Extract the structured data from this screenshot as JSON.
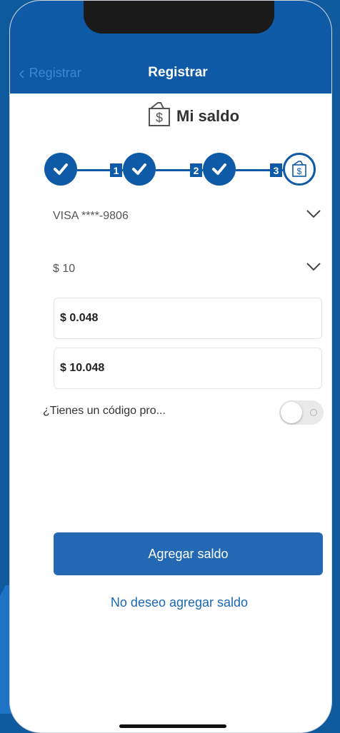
{
  "header": {
    "back_label": "Registrar",
    "title": "Registrar"
  },
  "section": {
    "title": "Mi saldo",
    "icon": "dollar-bill-icon"
  },
  "stepper": {
    "steps": [
      {
        "status": "completed"
      },
      {
        "number": "1",
        "status": "completed"
      },
      {
        "number": "2",
        "status": "completed"
      },
      {
        "number": "3",
        "status": "current"
      }
    ]
  },
  "form": {
    "card_select": "VISA ****-9806",
    "amount_select": "$ 10",
    "fee_value": "$ 0.048",
    "total_value": "$ 10.048",
    "promo_label": "¿Tienes un código pro...",
    "promo_toggle_on": false
  },
  "actions": {
    "primary_label": "Agregar saldo",
    "secondary_label": "No deseo agregar saldo"
  },
  "colors": {
    "brand": "#0e5aa6",
    "button": "#2268b3",
    "link": "#1a67b3"
  }
}
